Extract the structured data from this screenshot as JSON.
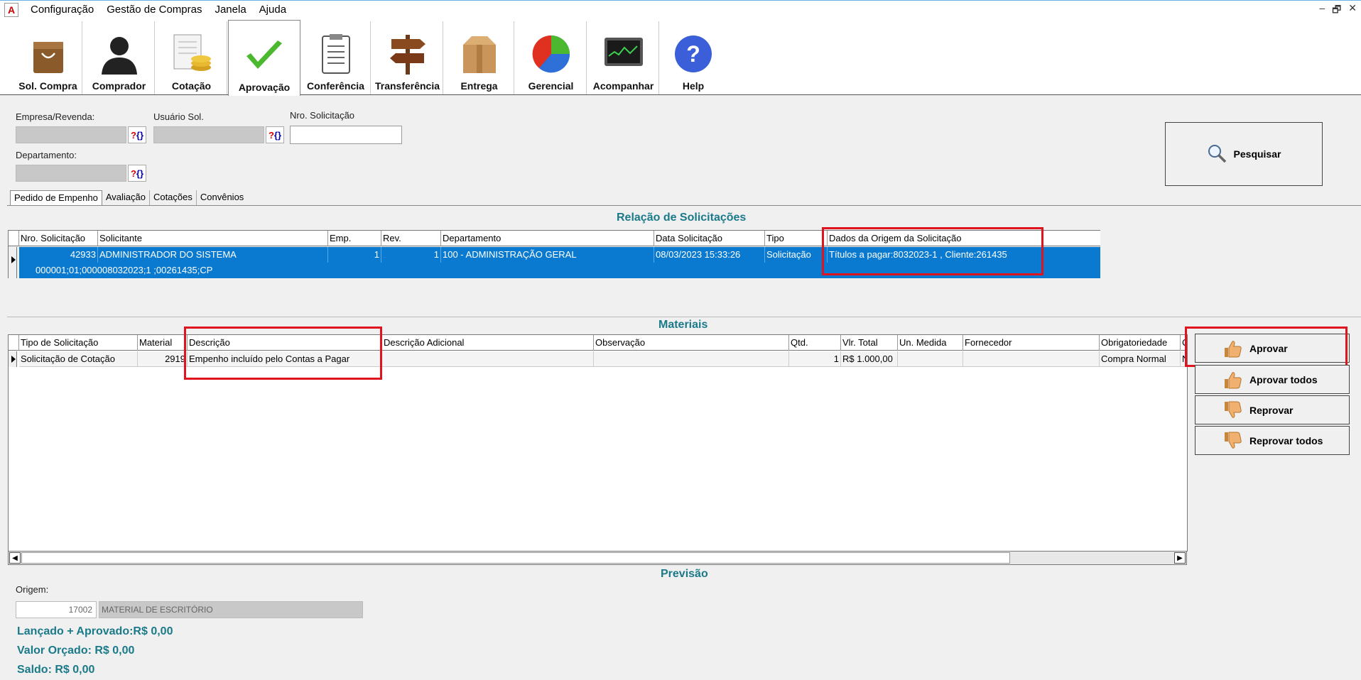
{
  "menu": {
    "items": [
      "Configuração",
      "Gestão de Compras",
      "Janela",
      "Ajuda"
    ],
    "window_controls": [
      "–",
      "🗗",
      "✕"
    ]
  },
  "toolbar": {
    "items": [
      {
        "label": "Sol. Compra",
        "icon": "shopping-bag-icon"
      },
      {
        "label": "Comprador",
        "icon": "person-icon"
      },
      {
        "label": "Cotação",
        "icon": "coins-receipt-icon"
      },
      {
        "label": "Aprovação",
        "icon": "checkmark-icon",
        "active": true
      },
      {
        "label": "Conferência",
        "icon": "clipboard-list-icon"
      },
      {
        "label": "Transferência",
        "icon": "signpost-icon"
      },
      {
        "label": "Entrega",
        "icon": "box-icon"
      },
      {
        "label": "Gerencial",
        "icon": "pie-chart-icon"
      },
      {
        "label": "Acompanhar",
        "icon": "monitor-chart-icon"
      },
      {
        "label": "Help",
        "icon": "help-icon"
      }
    ]
  },
  "filters": {
    "empresa_label": "Empresa/Revenda:",
    "usuario_label": "Usuário Sol.",
    "nro_label": "Nro. Solicitação",
    "departamento_label": "Departamento:",
    "lookup_q": "?",
    "lookup_b": "{}",
    "search_label": "Pesquisar"
  },
  "tabs": [
    "Pedido de Empenho",
    "Avaliação",
    "Cotações",
    "Convênios"
  ],
  "solicitacoes": {
    "title": "Relação de Solicitações",
    "columns": [
      "Nro. Solicitação",
      "Solicitante",
      "Emp.",
      "Rev.",
      "Departamento",
      "Data Solicitação",
      "Tipo",
      "Dados da Origem da Solicitação"
    ],
    "row": {
      "nro": "42933",
      "solicitante": "ADMINISTRADOR DO SISTEMA",
      "emp": "1",
      "rev": "1",
      "departamento": "100 - ADMINISTRAÇÃO GERAL",
      "data": "08/03/2023 15:33:26",
      "tipo": "Solicitação",
      "origem": "Títulos a pagar:8032023-1 , Cliente:261435",
      "detail": "000001;01;000008032023;1 ;00261435;CP"
    }
  },
  "materiais": {
    "title": "Materiais",
    "columns": [
      "Tipo de Solicitação",
      "Material",
      "Descrição",
      "Descrição Adicional",
      "Observação",
      "Qtd.",
      "Vlr. Total",
      "Un. Medida",
      "Fornecedor",
      "Obrigatoriedade",
      "C"
    ],
    "row": {
      "tipo": "Solicitação de Cotação",
      "material": "2919",
      "descricao": "Empenho incluído pelo Contas a Pagar",
      "descricao_adicional": "",
      "observacao": "",
      "qtd": "1",
      "vlr_total": "R$ 1.000,00",
      "un_medida": "",
      "fornecedor": "",
      "obrigatoriedade": "Compra Normal",
      "c": "N"
    }
  },
  "actions": {
    "aprovar": "Aprovar",
    "aprovar_todos": "Aprovar todos",
    "reprovar": "Reprovar",
    "reprovar_todos": "Reprovar todos"
  },
  "previsao": {
    "title": "Previsão",
    "origem_label": "Origem:",
    "origem_code": "17002",
    "origem_desc": "MATERIAL DE ESCRITÓRIO",
    "lancado": "Lançado + Aprovado:R$ 0,00",
    "orcado": "Valor Orçado: R$ 0,00",
    "saldo": "Saldo: R$ 0,00"
  },
  "colors": {
    "selection": "#0a7ad0",
    "teal": "#1a7a8a",
    "highlight": "#e0141e"
  }
}
